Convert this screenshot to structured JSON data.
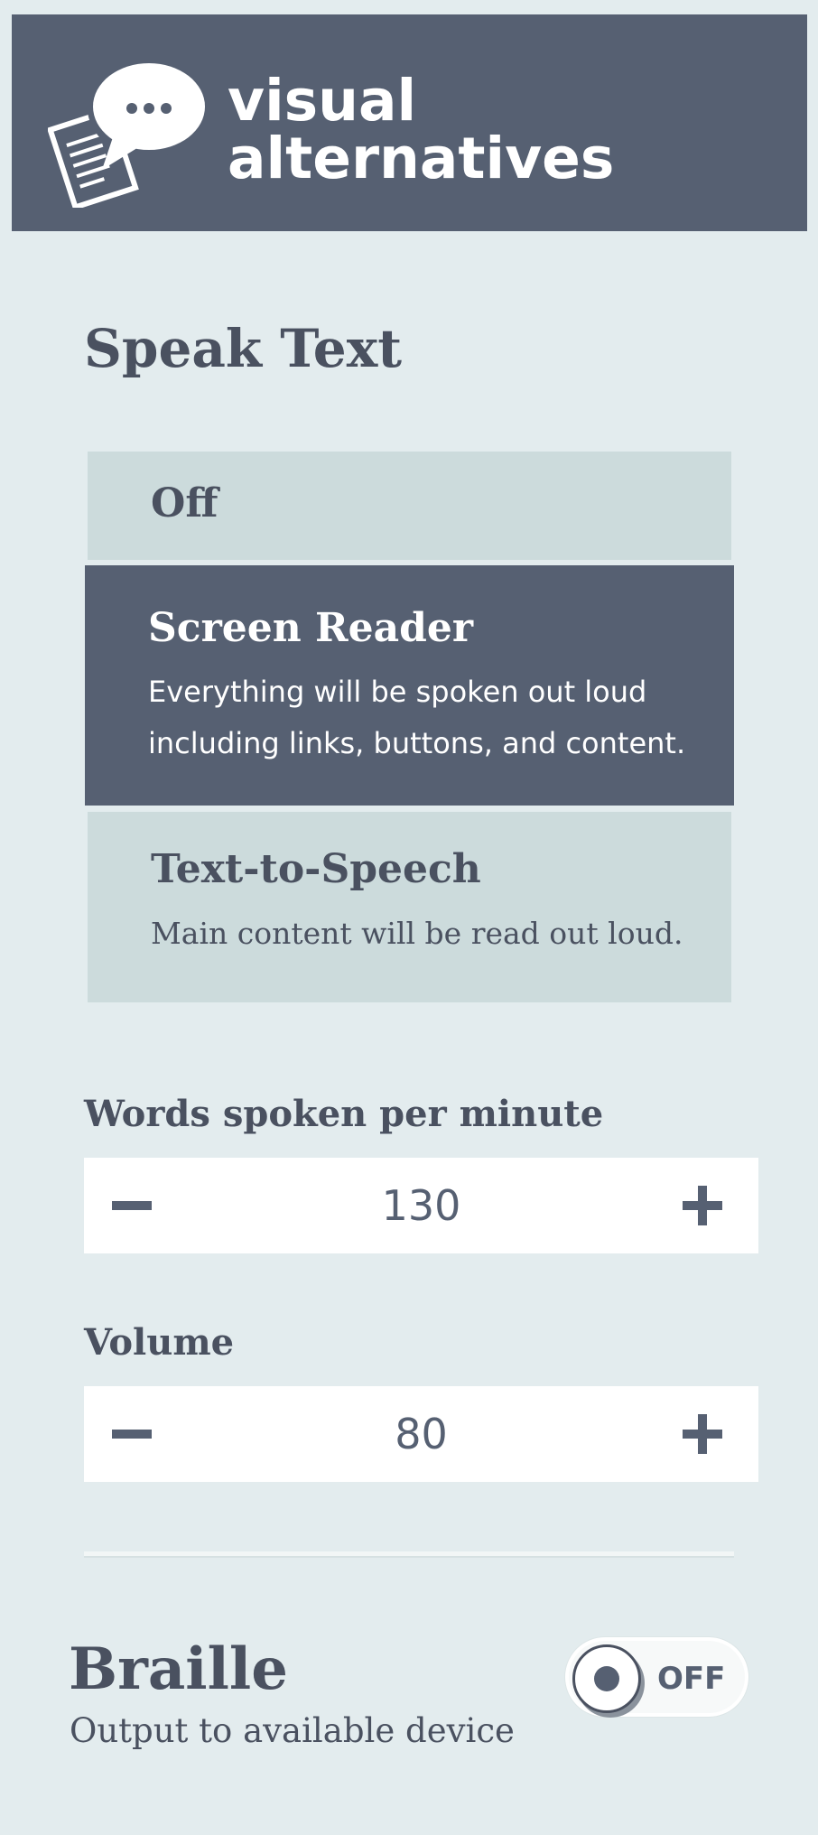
{
  "header": {
    "logo_icon": "speech-bubble-document-icon",
    "title_line1": "visual",
    "title_line2": "alternatives"
  },
  "speak_text": {
    "title": "Speak Text",
    "options": [
      {
        "title": "Off",
        "description": "",
        "selected": false
      },
      {
        "title": "Screen Reader",
        "description_line1": "Everything will be spoken out loud",
        "description_line2": "including links, buttons, and content.",
        "selected": true
      },
      {
        "title": "Text-to-Speech",
        "description": "Main content will be read out loud.",
        "selected": false
      }
    ]
  },
  "words_per_minute": {
    "label": "Words spoken per minute",
    "value": "130",
    "decrease_icon": "minus-icon",
    "increase_icon": "plus-icon"
  },
  "volume": {
    "label": "Volume",
    "value": "80",
    "decrease_icon": "minus-icon",
    "increase_icon": "plus-icon"
  },
  "braille": {
    "title": "Braille",
    "description": "Output to available device",
    "toggle_state": "OFF"
  },
  "colors": {
    "background": "#e3ecee",
    "header": "#566072",
    "option": "#ccdbdc",
    "selected": "#566072",
    "text": "#4a5160"
  }
}
